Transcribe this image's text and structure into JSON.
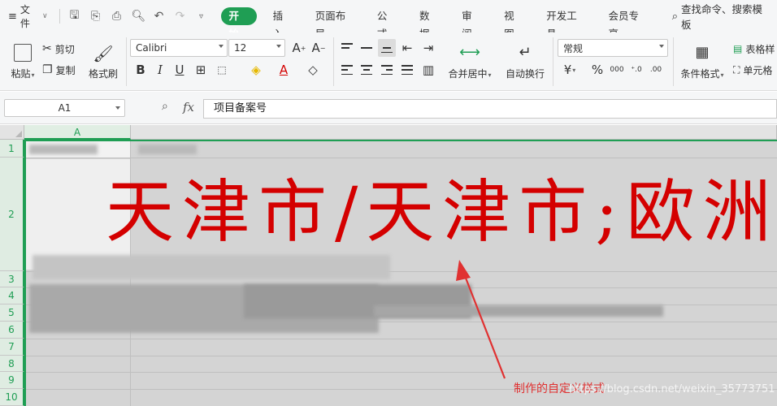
{
  "menu": {
    "file_label": "文件",
    "tabs": [
      "开始",
      "插入",
      "页面布局",
      "公式",
      "数据",
      "审阅",
      "视图",
      "开发工具",
      "会员专享"
    ],
    "search_label": "查找命令、搜索模板"
  },
  "ribbon": {
    "paste": "粘贴",
    "cut": "剪切",
    "copy": "复制",
    "format_painter": "格式刷",
    "font_name": "Calibri",
    "font_size": "12",
    "bold": "B",
    "italic": "I",
    "underline": "U",
    "merge_center": "合并居中",
    "wrap_text": "自动换行",
    "number_format": "常规",
    "currency": "¥",
    "percent": "%",
    "thousands": "000",
    "conditional_format": "条件格式",
    "table_style": "表格样",
    "cell_style": "单元格"
  },
  "formula_bar": {
    "name_box": "A1",
    "fx": "fx",
    "content": "项目备案号"
  },
  "sheet": {
    "columns": [
      "A"
    ],
    "rows": [
      "1",
      "2",
      "3",
      "4",
      "5",
      "6",
      "7",
      "8",
      "9",
      "10"
    ],
    "cell_large_text": "天津市/天津市;欧洲",
    "accent_color": "#1f9e54",
    "text_color": "#d40000"
  },
  "annotation": {
    "text": "制作的自定义样式",
    "color": "#e03131"
  },
  "watermark": "https://blog.csdn.net/weixin_35773751"
}
